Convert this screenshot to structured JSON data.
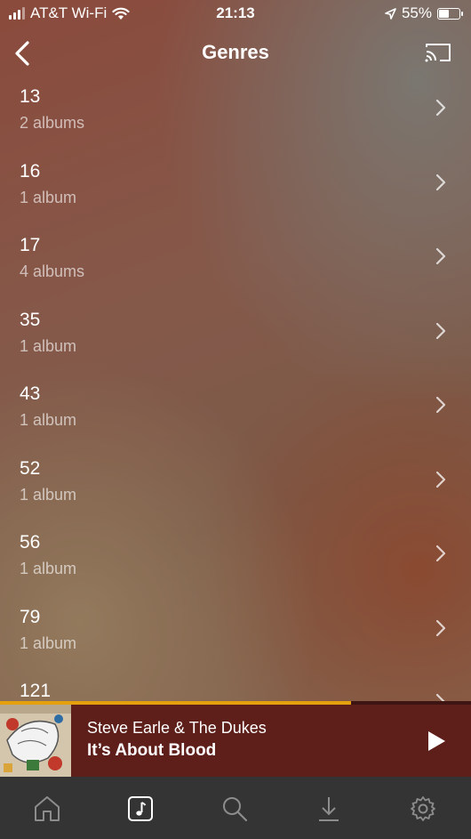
{
  "status": {
    "carrier": "AT&T Wi-Fi",
    "time": "21:13",
    "battery": "55%",
    "battery_level": 0.55
  },
  "header": {
    "title": "Genres",
    "back_icon": "back-chevron-icon",
    "cast_icon": "cast-icon"
  },
  "genres": [
    {
      "name": "13",
      "count": "2 albums"
    },
    {
      "name": "16",
      "count": "1 album"
    },
    {
      "name": "17",
      "count": "4 albums"
    },
    {
      "name": "35",
      "count": "1 album"
    },
    {
      "name": "43",
      "count": "1 album"
    },
    {
      "name": "52",
      "count": "1 album"
    },
    {
      "name": "56",
      "count": "1 album"
    },
    {
      "name": "79",
      "count": "1 album"
    },
    {
      "name": "121",
      "count": ""
    }
  ],
  "now_playing": {
    "artist": "Steve Earle & The Dukes",
    "title": "It’s About Blood",
    "progress": 0.745
  },
  "tabs": [
    {
      "name": "tab-home",
      "icon": "home-icon",
      "active": false
    },
    {
      "name": "tab-music",
      "icon": "music-note-icon",
      "active": true
    },
    {
      "name": "tab-search",
      "icon": "search-icon",
      "active": false
    },
    {
      "name": "tab-downloads",
      "icon": "download-icon",
      "active": false
    },
    {
      "name": "tab-settings",
      "icon": "gear-icon",
      "active": false
    }
  ],
  "colors": {
    "accent": "#e5a00d",
    "player_bg": "#5e1f1a",
    "tab_bar_bg": "#343434"
  }
}
